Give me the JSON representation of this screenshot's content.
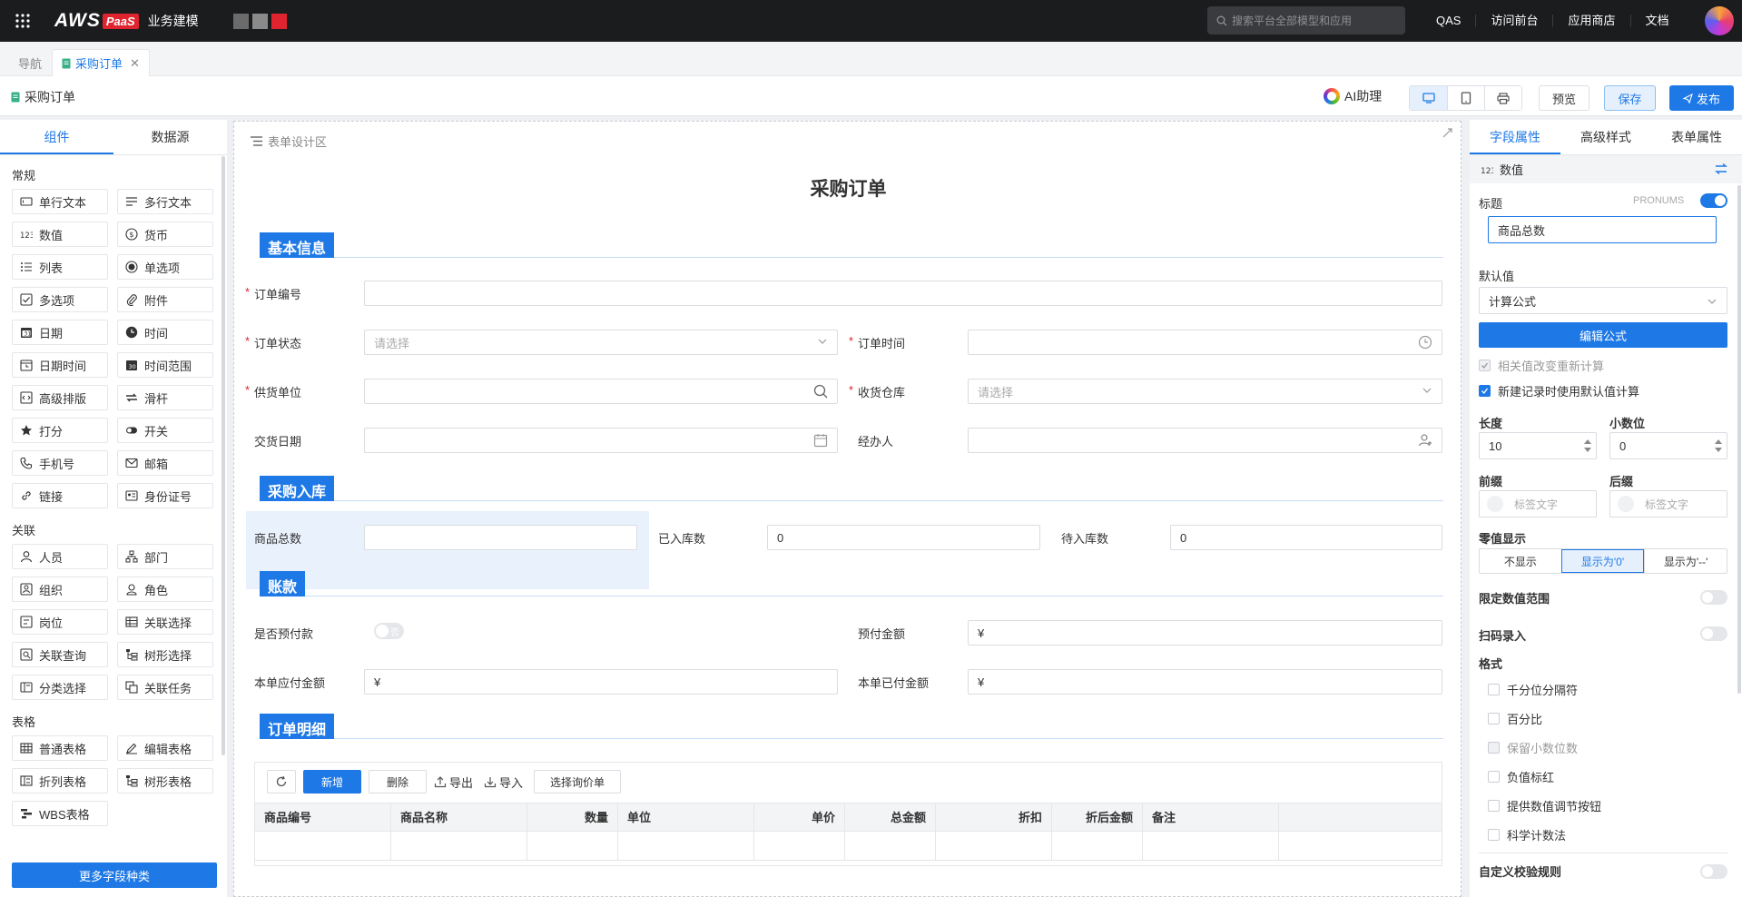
{
  "topbar": {
    "brand": "AWS",
    "brand_badge": "PaaS",
    "app_title": "业务建模",
    "swatch_colors": [
      "#6b6b6b",
      "#8a8a8a",
      "#e0242f"
    ],
    "search_placeholder": "搜索平台全部模型和应用",
    "links": [
      "QAS",
      "访问前台",
      "应用商店",
      "文档"
    ]
  },
  "tabs": {
    "nav": "导航",
    "active": "采购订单"
  },
  "header": {
    "page_title": "采购订单",
    "ai_label": "AI助理",
    "preview": "预览",
    "save": "保存",
    "publish": "发布"
  },
  "left": {
    "tabs": [
      "组件",
      "数据源"
    ],
    "groups": [
      {
        "title": "常规",
        "items": [
          {
            "label": "单行文本",
            "icon": "single-line-text-icon"
          },
          {
            "label": "多行文本",
            "icon": "multi-line-text-icon"
          },
          {
            "label": "数值",
            "icon": "number-icon"
          },
          {
            "label": "货币",
            "icon": "currency-icon"
          },
          {
            "label": "列表",
            "icon": "list-icon"
          },
          {
            "label": "单选项",
            "icon": "radio-icon"
          },
          {
            "label": "多选项",
            "icon": "checkbox-icon"
          },
          {
            "label": "附件",
            "icon": "attachment-icon"
          },
          {
            "label": "日期",
            "icon": "date-icon"
          },
          {
            "label": "时间",
            "icon": "clock-icon"
          },
          {
            "label": "日期时间",
            "icon": "datetime-icon"
          },
          {
            "label": "时间范围",
            "icon": "time-range-icon"
          },
          {
            "label": "高级排版",
            "icon": "code-icon"
          },
          {
            "label": "滑杆",
            "icon": "slider-icon"
          },
          {
            "label": "打分",
            "icon": "star-icon"
          },
          {
            "label": "开关",
            "icon": "switch-icon"
          },
          {
            "label": "手机号",
            "icon": "phone-icon"
          },
          {
            "label": "邮箱",
            "icon": "mail-icon"
          },
          {
            "label": "链接",
            "icon": "link-icon"
          },
          {
            "label": "身份证号",
            "icon": "id-card-icon"
          }
        ]
      },
      {
        "title": "关联",
        "items": [
          {
            "label": "人员",
            "icon": "user-icon"
          },
          {
            "label": "部门",
            "icon": "department-icon"
          },
          {
            "label": "组织",
            "icon": "organization-icon"
          },
          {
            "label": "角色",
            "icon": "role-icon"
          },
          {
            "label": "岗位",
            "icon": "position-icon"
          },
          {
            "label": "关联选择",
            "icon": "table-select-icon"
          },
          {
            "label": "关联查询",
            "icon": "query-icon"
          },
          {
            "label": "树形选择",
            "icon": "tree-icon"
          },
          {
            "label": "分类选择",
            "icon": "category-icon"
          },
          {
            "label": "关联任务",
            "icon": "task-icon"
          }
        ]
      },
      {
        "title": "表格",
        "items": [
          {
            "label": "普通表格",
            "icon": "table-icon"
          },
          {
            "label": "编辑表格",
            "icon": "edit-table-icon"
          },
          {
            "label": "折列表格",
            "icon": "fold-table-icon"
          },
          {
            "label": "树形表格",
            "icon": "tree-table-icon"
          },
          {
            "label": "WBS表格",
            "icon": "wbs-icon"
          }
        ]
      }
    ],
    "more_button": "更多字段种类"
  },
  "canvas": {
    "area_label": "表单设计区",
    "form_title": "采购订单",
    "sections": {
      "basic": "基本信息",
      "stock": "采购入库",
      "payment": "账款",
      "detail": "订单明细"
    },
    "fields": {
      "order_no": "订单编号",
      "order_status": "订单状态",
      "order_status_ph": "请选择",
      "order_time": "订单时间",
      "supplier": "供货单位",
      "warehouse": "收货仓库",
      "warehouse_ph": "请选择",
      "delivery_date": "交货日期",
      "handler": "经办人",
      "total_goods": "商品总数",
      "stocked": "已入库数",
      "stocked_val": "0",
      "pending": "待入库数",
      "pending_val": "0",
      "prepaid": "是否预付款",
      "prepaid_toggle": "否",
      "prepaid_amount": "预付金额",
      "payable": "本单应付金额",
      "paid": "本单已付金额",
      "currency_symbol": "¥"
    },
    "table": {
      "add": "新增",
      "delete": "删除",
      "export": "导出",
      "import": "导入",
      "select_inquiry": "选择询价单",
      "columns": [
        "商品编号",
        "商品名称",
        "数量",
        "单位",
        "单价",
        "总金额",
        "折扣",
        "折后金额",
        "备注"
      ]
    }
  },
  "right": {
    "tabs": [
      "字段属性",
      "高级样式",
      "表单属性"
    ],
    "field_type": "数值",
    "title_label": "标题",
    "pronums": "PRONUMS",
    "title_value": "商品总数",
    "default_label": "默认值",
    "default_value": "计算公式",
    "edit_formula": "编辑公式",
    "recalc": "相关值改变重新计算",
    "new_record_default": "新建记录时使用默认值计算",
    "length_label": "长度",
    "length_value": "10",
    "decimal_label": "小数位",
    "decimal_value": "0",
    "prefix_label": "前缀",
    "suffix_label": "后缀",
    "tag_text": "标签文字",
    "zero_label": "零值显示",
    "zero_options": [
      "不显示",
      "显示为'0'",
      "显示为'--'"
    ],
    "zero_selected": 1,
    "limit_range": "限定数值范围",
    "scan_input": "扫码录入",
    "format_label": "格式",
    "format_options": [
      "千分位分隔符",
      "百分比",
      "保留小数位数",
      "负值标红",
      "提供数值调节按钮",
      "科学计数法"
    ],
    "custom_rule": "自定义校验规则"
  }
}
